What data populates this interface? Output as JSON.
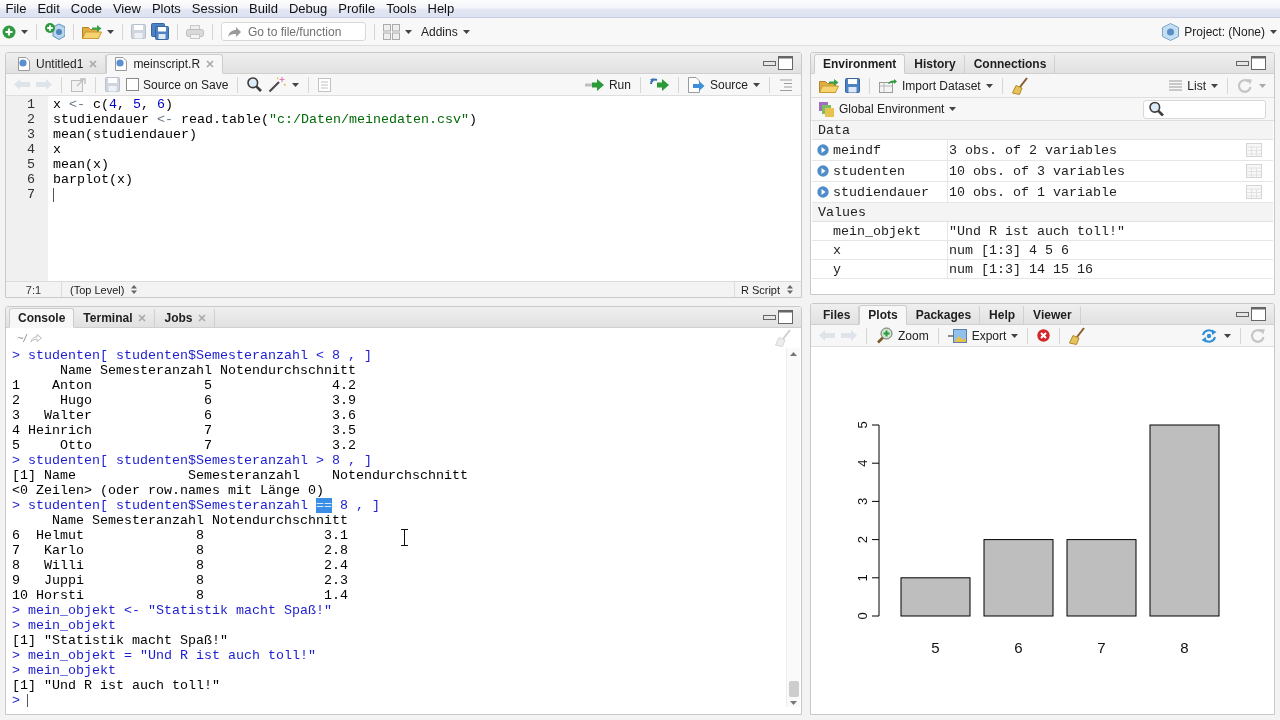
{
  "menu_bar": {
    "items": [
      "File",
      "Edit",
      "Code",
      "View",
      "Plots",
      "Session",
      "Build",
      "Debug",
      "Profile",
      "Tools",
      "Help"
    ]
  },
  "toolbar": {
    "goto_field": {
      "placeholder": "Go to file/function"
    },
    "addins": "Addins",
    "project": "Project: (None)"
  },
  "source": {
    "tabs": [
      {
        "label": "Untitled1",
        "selected": false,
        "closable": true
      },
      {
        "label": "meinscript.R",
        "selected": true,
        "closable": true
      }
    ],
    "source_on_save": {
      "label": "Source on Save",
      "checked": false
    },
    "run_button": "Run",
    "source_button": "Source",
    "lines": [
      {
        "number": "1",
        "tokens": [
          {
            "kind": "text",
            "text": "x "
          },
          {
            "kind": "operator",
            "text": "<-"
          },
          {
            "kind": "text",
            "text": " c("
          },
          {
            "kind": "number",
            "text": "4"
          },
          {
            "kind": "text",
            "text": ", "
          },
          {
            "kind": "number",
            "text": "5"
          },
          {
            "kind": "text",
            "text": ", "
          },
          {
            "kind": "number",
            "text": "6"
          },
          {
            "kind": "text",
            "text": ")"
          }
        ]
      },
      {
        "number": "2",
        "tokens": [
          {
            "kind": "text",
            "text": "studiendauer "
          },
          {
            "kind": "operator",
            "text": "<-"
          },
          {
            "kind": "text",
            "text": " read.table("
          },
          {
            "kind": "string",
            "text": "\"c:/Daten/meinedaten.csv\""
          },
          {
            "kind": "text",
            "text": ")"
          }
        ]
      },
      {
        "number": "3",
        "tokens": [
          {
            "kind": "text",
            "text": "mean(studiendauer)"
          }
        ]
      },
      {
        "number": "4",
        "tokens": [
          {
            "kind": "text",
            "text": "x"
          }
        ]
      },
      {
        "number": "5",
        "tokens": [
          {
            "kind": "text",
            "text": "mean(x)"
          }
        ]
      },
      {
        "number": "6",
        "tokens": [
          {
            "kind": "text",
            "text": "barplot(x)"
          }
        ]
      },
      {
        "number": "7"
      }
    ],
    "status": {
      "position": "7:1",
      "scope": "(Top Level)",
      "file_type": "R Script"
    }
  },
  "console": {
    "tabs": [
      {
        "label": "Console",
        "selected": true,
        "closable": false
      },
      {
        "label": "Terminal",
        "selected": false,
        "closable": true
      },
      {
        "label": "Jobs",
        "selected": false,
        "closable": true
      }
    ],
    "path": "~/",
    "lines": [
      {
        "kind": "input",
        "text": "> studenten[ studenten$Semesteranzahl < 8 , ]"
      },
      {
        "kind": "output",
        "text": "      Name Semesteranzahl Notendurchschnitt"
      },
      {
        "kind": "output",
        "text": "1    Anton              5               4.2"
      },
      {
        "kind": "output",
        "text": "2     Hugo              6               3.9"
      },
      {
        "kind": "output",
        "text": "3   Walter              6               3.6"
      },
      {
        "kind": "output",
        "text": "4 Heinrich              7               3.5"
      },
      {
        "kind": "output",
        "text": "5     Otto              7               3.2"
      },
      {
        "kind": "input",
        "text": "> studenten[ studenten$Semesteranzahl > 8 , ]"
      },
      {
        "kind": "output",
        "text": "[1] Name              Semesteranzahl    Notendurchschnitt"
      },
      {
        "kind": "output",
        "text": "<0 Zeilen> (oder row.names mit Länge 0)"
      },
      {
        "kind": "input",
        "parts": [
          {
            "text": "> studenten[ studenten$Semesteranzahl ",
            "selected": false
          },
          {
            "text": "==",
            "selected": true
          },
          {
            "text": " 8 , ]",
            "selected": false
          }
        ]
      },
      {
        "kind": "output",
        "text": "     Name Semesteranzahl Notendurchschnitt"
      },
      {
        "kind": "output",
        "text": "6  Helmut              8               3.1"
      },
      {
        "kind": "output",
        "text": "7   Karlo              8               2.8"
      },
      {
        "kind": "output",
        "text": "8   Willi              8               2.4"
      },
      {
        "kind": "output",
        "text": "9   Juppi              8               2.3"
      },
      {
        "kind": "output",
        "text": "10 Horsti              8               1.4"
      },
      {
        "kind": "input",
        "text": "> mein_objekt <- \"Statistik macht Spaß!\""
      },
      {
        "kind": "input",
        "text": "> mein_objekt"
      },
      {
        "kind": "output",
        "text": "[1] \"Statistik macht Spaß!\""
      },
      {
        "kind": "input",
        "text": "> mein_objekt = \"Und R ist auch toll!\""
      },
      {
        "kind": "input",
        "text": "> mein_objekt"
      },
      {
        "kind": "output",
        "text": "[1] \"Und R ist auch toll!\""
      },
      {
        "kind": "prompt",
        "text": ">"
      }
    ]
  },
  "environment": {
    "tabs": [
      {
        "label": "Environment",
        "selected": true
      },
      {
        "label": "History",
        "selected": false
      },
      {
        "label": "Connections",
        "selected": false
      }
    ],
    "import_button": "Import Dataset",
    "view_button": "List",
    "scope": "Global Environment",
    "sections": [
      {
        "title": "Data",
        "rows": [
          {
            "kind": "data",
            "name": "meindf",
            "value": "3 obs. of 2 variables"
          },
          {
            "kind": "data",
            "name": "studenten",
            "value": "10 obs. of 3 variables"
          },
          {
            "kind": "data",
            "name": "studiendauer",
            "value": "10 obs. of 1 variable"
          }
        ]
      },
      {
        "title": "Values",
        "rows": [
          {
            "kind": "value",
            "name": "mein_objekt",
            "value": "\"Und R ist auch toll!\""
          },
          {
            "kind": "value",
            "name": "x",
            "value": "num [1:3] 4 5 6"
          },
          {
            "kind": "value",
            "name": "y",
            "value": "num [1:3] 14 15 16"
          }
        ]
      }
    ]
  },
  "files_pane": {
    "tabs": [
      {
        "label": "Files",
        "selected": false
      },
      {
        "label": "Plots",
        "selected": true
      },
      {
        "label": "Packages",
        "selected": false
      },
      {
        "label": "Help",
        "selected": false
      },
      {
        "label": "Viewer",
        "selected": false
      }
    ],
    "zoom_button": "Zoom",
    "export_button": "Export",
    "chart_data": {
      "type": "bar",
      "categories": [
        "5",
        "6",
        "7",
        "8"
      ],
      "values": [
        1,
        2,
        2,
        5
      ],
      "ylim": [
        0,
        5
      ],
      "yticks": [
        0,
        1,
        2,
        3,
        4,
        5
      ]
    }
  }
}
